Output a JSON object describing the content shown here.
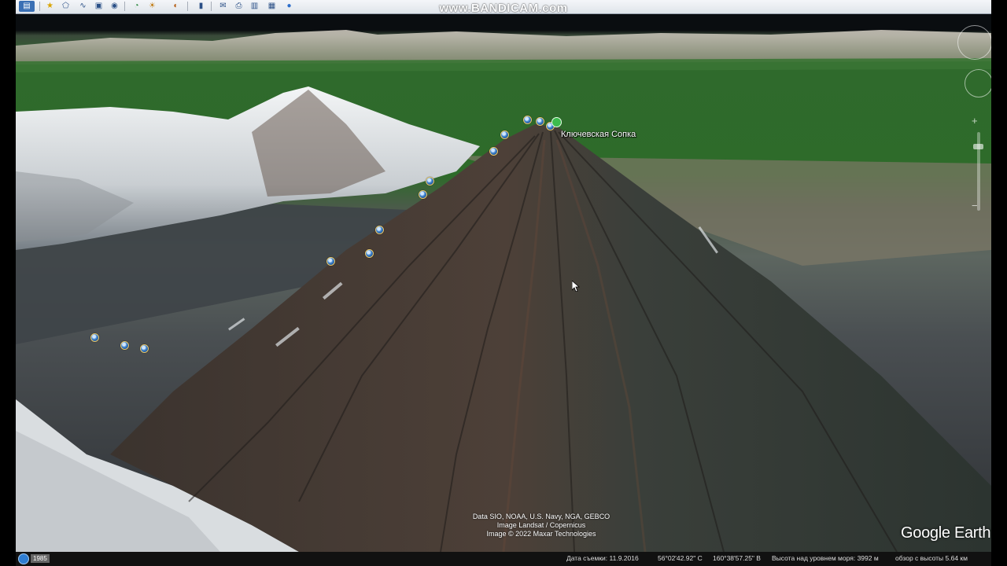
{
  "watermark": "www.BANDICAM.com",
  "toolbar": {
    "icons": [
      "sidebar-toggle-icon",
      "placemark-icon",
      "polygon-icon",
      "path-icon",
      "overlay-icon",
      "tour-icon",
      "historical-imagery-icon",
      "sun-icon",
      "planet-icon",
      "ruler-icon",
      "email-icon",
      "print-icon",
      "save-image-icon",
      "map-icon",
      "web-icon"
    ]
  },
  "map": {
    "place_label": "Ключевская Сопка",
    "attribution": {
      "line1": "Data SIO, NOAA, U.S. Navy, NGA, GEBCO",
      "line2": "Image Landsat / Copernicus",
      "line3": "Image © 2022 Maxar Technologies"
    },
    "logo": "Google Earth"
  },
  "status": {
    "year": "1985",
    "date": "Дата съемки: 11.9.2016",
    "lat": "56°02'42.92\" С",
    "lon": "160°38'57.25\" В",
    "elevation": "Высота над уровнем моря:  3992 м",
    "eye_alt": "обзор с высоты    5.64 км"
  }
}
